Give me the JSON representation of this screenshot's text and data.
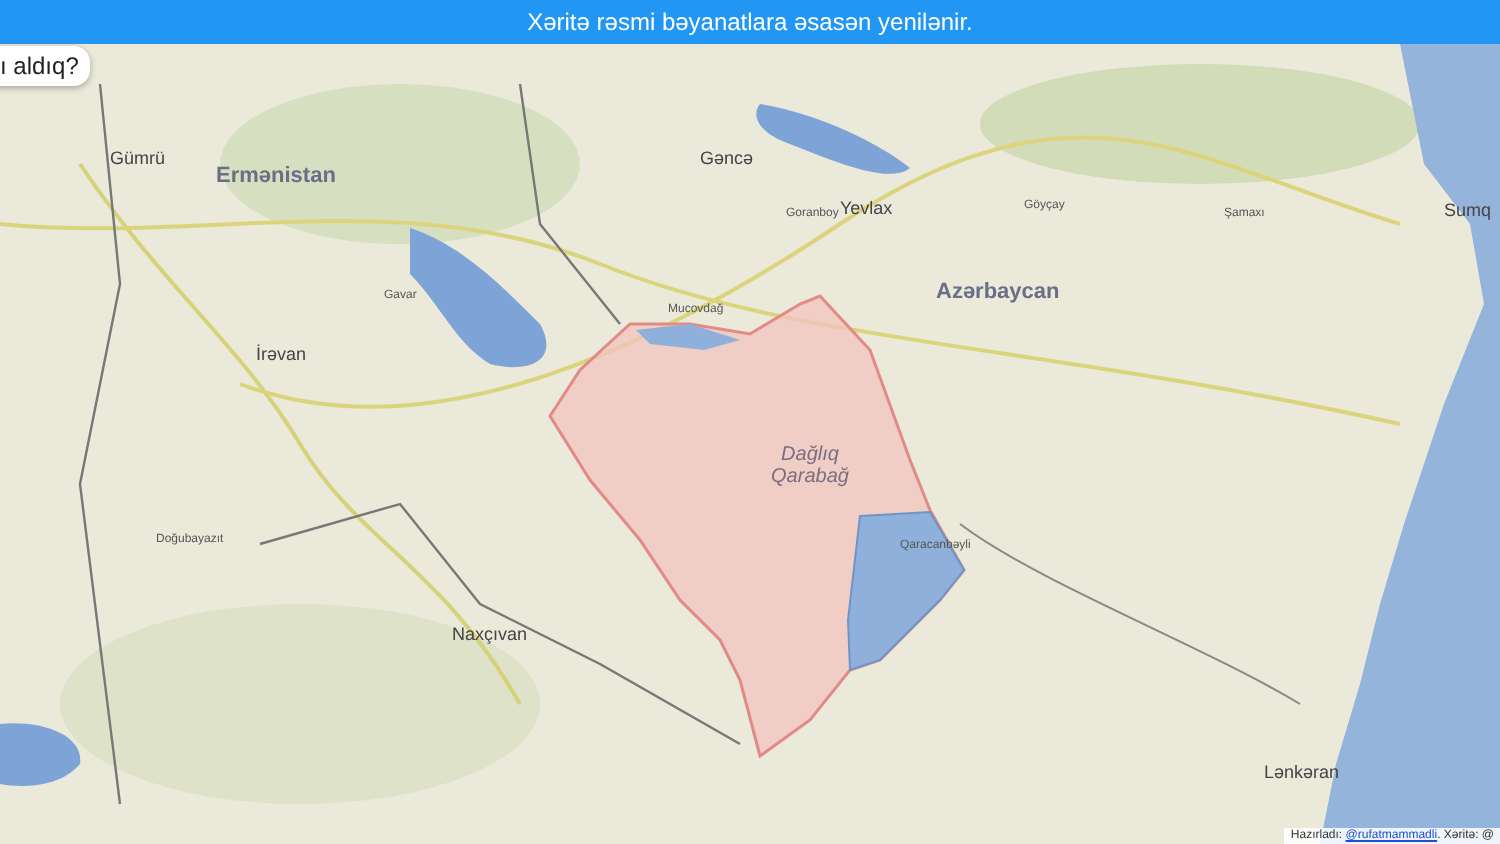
{
  "banner": {
    "text": "Xəritə rəsmi bəyanatlara əsasən yenilənir."
  },
  "bubble": {
    "text": "ı aldıq?"
  },
  "map": {
    "labels": [
      {
        "text": "Gümrü",
        "kind": "city"
      },
      {
        "text": "Ermənistan",
        "kind": "country"
      },
      {
        "text": "Gəncə",
        "kind": "city"
      },
      {
        "text": "Yevlax",
        "kind": "city"
      },
      {
        "text": "Azərbaycan",
        "kind": "country"
      },
      {
        "text": "Sumq",
        "kind": "city"
      },
      {
        "text": "Gavar",
        "kind": "town"
      },
      {
        "text": "Goranboy",
        "kind": "town"
      },
      {
        "text": "Göyçay",
        "kind": "town"
      },
      {
        "text": "Şamaxı",
        "kind": "town"
      },
      {
        "text": "İrəvan",
        "kind": "city"
      },
      {
        "text": "Mucovdağ",
        "kind": "town"
      },
      {
        "text": "Dağlıq Qarabağ",
        "kind": "region"
      },
      {
        "text": "Qaracanbəyli",
        "kind": "town"
      },
      {
        "text": "Doğubayazıt",
        "kind": "town"
      },
      {
        "text": "Naxçıvan",
        "kind": "city"
      },
      {
        "text": "Lənkəran",
        "kind": "city"
      }
    ]
  },
  "attribution": {
    "prefix": "Hazırladı:",
    "link": "@rufatmammadli",
    "suffix": ". Xəritə: @"
  }
}
